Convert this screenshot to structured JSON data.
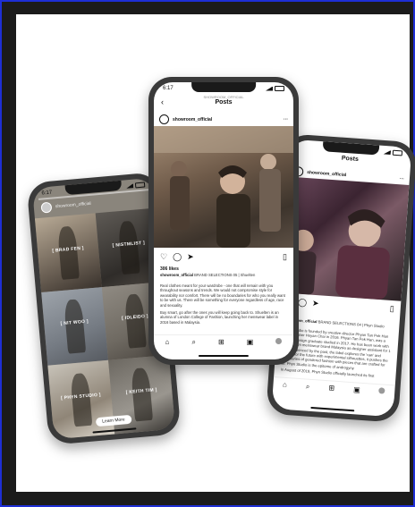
{
  "left_phone": {
    "time": "6:17",
    "username": "showroom_official",
    "tiles": [
      {
        "label": "[ BRAD FEN ]"
      },
      {
        "label": "[ NISTMLIST ]"
      },
      {
        "label": "[ NIT WOO ]"
      },
      {
        "label": "[ IDLEIDO ]"
      },
      {
        "label": "[ PHYN STUDIO ]"
      },
      {
        "label": "[ KEITH TIM ]"
      }
    ],
    "learn_more": "Learn More"
  },
  "center_phone": {
    "time": "6:17",
    "header_sub": "SHOWROOM_OFFICIAL",
    "header_title": "Posts",
    "username": "showroom_official",
    "likes": "306 likes",
    "caption_user": "showroom_official",
    "caption_text": "BRAND SELECTIONS 05 | Shuelten",
    "body1": "Real clothes meant for your wardrobe - one that will remain with you throughout seasons and trends. We would not compromise style for wearability nor comfort. There will be no boundaries for who you really want to be with us. There will be something for everyone regardless of age, race and sexuality.",
    "body2": "Buy smart, go after the ones you will keep going back to. Shuelten is an alumna of London College of Fashion, launching her menswear label in 2016 based in Malaysia."
  },
  "right_phone": {
    "header_title": "Posts",
    "username": "showroom_official",
    "likes": "likes",
    "caption_user": "showroom_official",
    "caption_text": "BRAND SELECTIONS 04 | Phyn Studio",
    "body1": "Phyn Studio is founded by creative director Phyan Tan Pek Han and designer Hoyan Chai in 2016. Phyan Tan Pek Han, was a fashion design graduate studied in 2017. He has been work with local grown menswear brand Malaysia as designer assistant for 1 year, influenced by the past, the label explores the 'raw' and mirrors for the future with experimental silhouettes, it pushes the boundaries of gendered fashion with pieces that are crafted for all. Phyn Studio is the epitome of androgyny.",
    "body2": "In August of 2019, Phyn Studio officially launched its first collection - The Story of A New Name. The first collection is heavily illustrated to introduce the"
  }
}
